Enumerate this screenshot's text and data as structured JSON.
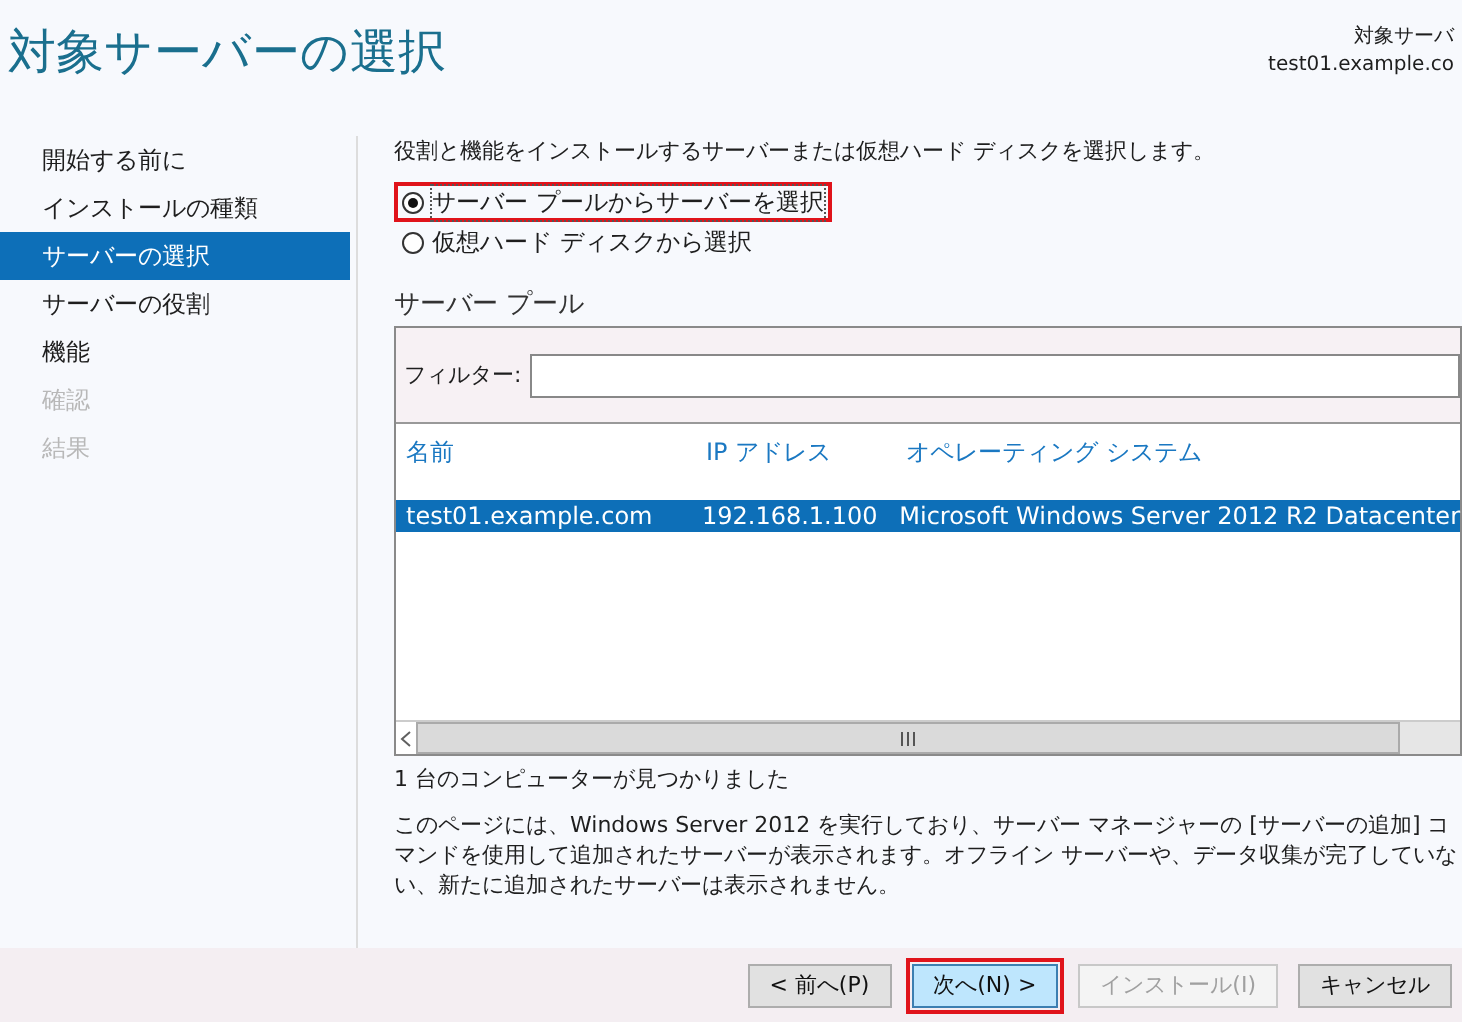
{
  "header": {
    "title": "対象サーバーの選択",
    "destination_label": "対象サーバ",
    "destination_server": "test01.example.co"
  },
  "sidebar": {
    "items": [
      {
        "label": "開始する前に",
        "selected": false,
        "disabled": false
      },
      {
        "label": "インストールの種類",
        "selected": false,
        "disabled": false
      },
      {
        "label": "サーバーの選択",
        "selected": true,
        "disabled": false
      },
      {
        "label": "サーバーの役割",
        "selected": false,
        "disabled": false
      },
      {
        "label": "機能",
        "selected": false,
        "disabled": false
      },
      {
        "label": "確認",
        "selected": false,
        "disabled": true
      },
      {
        "label": "結果",
        "selected": false,
        "disabled": true
      }
    ]
  },
  "intro": "役割と機能をインストールするサーバーまたは仮想ハード ディスクを選択します。",
  "options": [
    {
      "label": "サーバー プールからサーバーを選択",
      "selected": true,
      "highlighted": true
    },
    {
      "label": "仮想ハード ディスクから選択",
      "selected": false,
      "highlighted": false
    }
  ],
  "pool": {
    "title": "サーバー プール",
    "filter_label": "フィルター:",
    "columns": [
      "名前",
      "IP アドレス",
      "オペレーティング システム"
    ],
    "rows": [
      {
        "cells": [
          "test01.example.com",
          "192.168.1.100",
          "Microsoft Windows Server 2012 R2 Datacenter"
        ],
        "selected": true
      }
    ]
  },
  "found": "1 台のコンピューターが見つかりました",
  "description": "このページには、Windows Server 2012 を実行しており、サーバー マネージャーの [サーバーの追加] コマンドを使用して追加されたサーバーが表示されます。オフライン サーバーや、データ収集が完了していない、新たに追加されたサーバーは表示されません。",
  "buttons": [
    {
      "label": "< 前へ(P)",
      "disabled": false,
      "highlighted": false,
      "default": false
    },
    {
      "label": "次へ(N) >",
      "disabled": false,
      "highlighted": true,
      "default": true
    },
    {
      "label": "インストール(I)",
      "disabled": true,
      "highlighted": false,
      "default": false
    },
    {
      "label": "キャンセル",
      "disabled": false,
      "highlighted": false,
      "default": false
    }
  ]
}
